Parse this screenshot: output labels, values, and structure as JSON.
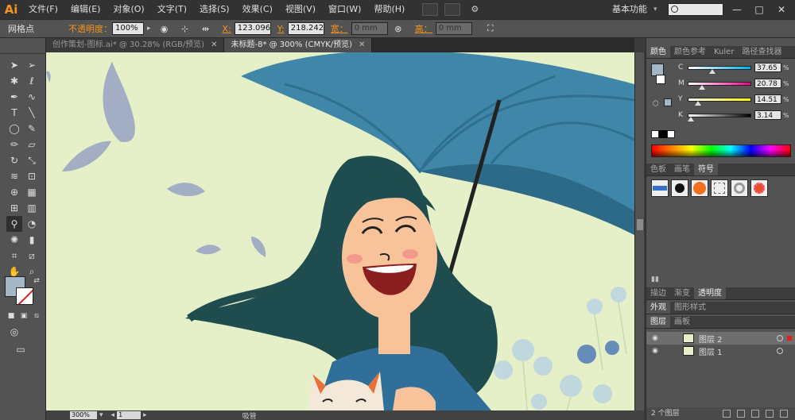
{
  "app": {
    "logo": "Ai"
  },
  "menu": [
    "文件(F)",
    "编辑(E)",
    "对象(O)",
    "文字(T)",
    "选择(S)",
    "效果(C)",
    "视图(V)",
    "窗口(W)",
    "帮助(H)"
  ],
  "workspace": {
    "label": "基本功能",
    "caret": "▾"
  },
  "window_buttons": [
    "—",
    "□",
    "✕"
  ],
  "control_bar": {
    "anchor_label": "网格点",
    "opacity_label": "不透明度：",
    "opacity_value": "100%",
    "x_label": "X:",
    "x_value": "123.096",
    "y_label": "Y:",
    "y_value": "218.242",
    "w_label": "宽：",
    "w_value": "0 mm",
    "h_label": "高：",
    "h_value": "0 mm"
  },
  "tabs": [
    {
      "label": "创作策划-图标.ai* @ 30.28% (RGB/预览)",
      "close": "✕"
    },
    {
      "label": "未标题-8* @ 300% (CMYK/预览)",
      "close": "✕"
    }
  ],
  "status_bar": {
    "zoom": "300%",
    "page": "1",
    "tool_name": "吸管"
  },
  "color_panel": {
    "tabs": [
      "颜色",
      "颜色参考",
      "Kuler",
      "路径查找器"
    ],
    "channels": [
      {
        "letter": "C",
        "value": "37.65",
        "pct": "%",
        "level": 0.3765,
        "track": "linear-gradient(to right,#fff,#00aeef)"
      },
      {
        "letter": "M",
        "value": "20.78",
        "pct": "%",
        "level": 0.2078,
        "track": "linear-gradient(to right,#fff,#ec008c)"
      },
      {
        "letter": "Y",
        "value": "14.51",
        "pct": "%",
        "level": 0.1451,
        "track": "linear-gradient(to right,#fff,#fff200)"
      },
      {
        "letter": "K",
        "value": "3.14",
        "pct": "%",
        "level": 0.0314,
        "track": "linear-gradient(to right,#fff,#000)"
      }
    ],
    "fill_color": "#a4b7c7"
  },
  "symbols_panel": {
    "tabs": [
      "色板",
      "画笔",
      "符号"
    ]
  },
  "transparency_panel": {
    "tabs": [
      "描边",
      "渐变",
      "透明度"
    ]
  },
  "appearance_panel": {
    "tabs": [
      "外观",
      "图形样式"
    ]
  },
  "layers_panel": {
    "tabs": [
      "图层",
      "画板"
    ],
    "layers": [
      {
        "name": "图层 2",
        "selected": true
      },
      {
        "name": "图层 1",
        "selected": false
      }
    ],
    "footer": "2 个图层"
  },
  "colors": {
    "canvas_bg": "#e6f0c8",
    "umbrella": "#3f86a8",
    "hair": "#1f4d4f",
    "skin": "#f8c29a",
    "shirt": "#2f6f9a",
    "leaf": "#a3aec4",
    "accent": "#f7941d"
  }
}
